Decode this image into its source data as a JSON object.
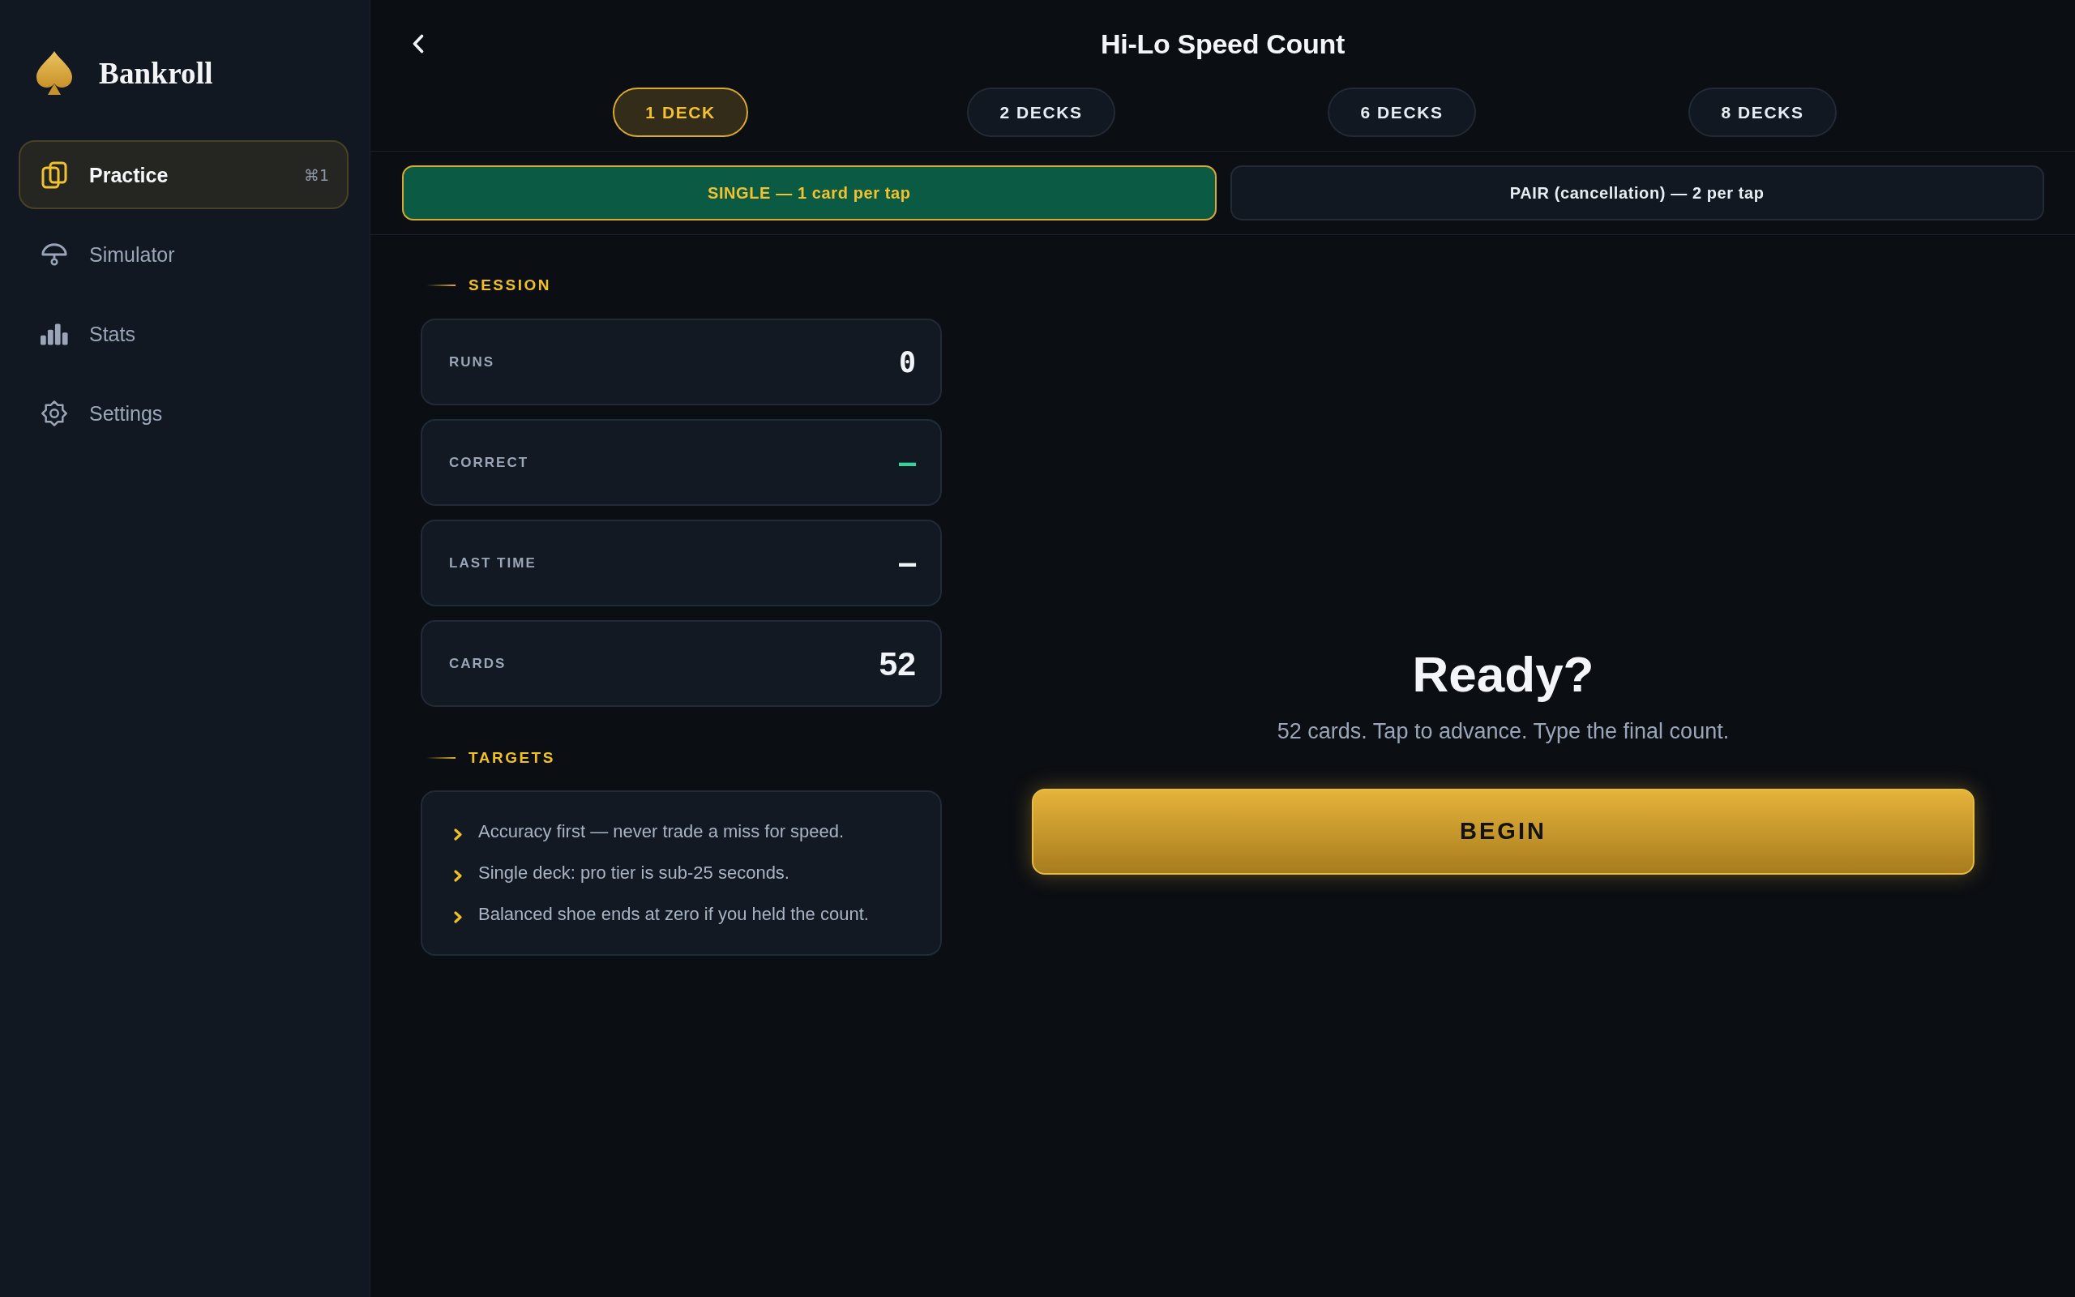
{
  "sidebar": {
    "brand": "Bankroll",
    "items": [
      {
        "label": "Practice",
        "shortcut": "⌘1",
        "selected": true
      },
      {
        "label": "Simulator",
        "selected": false
      },
      {
        "label": "Stats",
        "selected": false
      },
      {
        "label": "Settings",
        "selected": false
      }
    ]
  },
  "header": {
    "title": "Hi-Lo Speed Count"
  },
  "deck_tabs": [
    {
      "label": "1 DECK",
      "selected": true
    },
    {
      "label": "2 DECKS",
      "selected": false
    },
    {
      "label": "6 DECKS",
      "selected": false
    },
    {
      "label": "8 DECKS",
      "selected": false
    }
  ],
  "modes": [
    {
      "label": "SINGLE — 1 card per tap",
      "selected": true
    },
    {
      "label": "PAIR (cancellation) — 2 per tap",
      "selected": false
    }
  ],
  "session": {
    "heading": "SESSION",
    "stats": [
      {
        "label": "RUNS",
        "value": "0",
        "kind": "mono",
        "color": "#f1f5f9"
      },
      {
        "label": "CORRECT",
        "value": "—",
        "kind": "mono",
        "color": "#34d399"
      },
      {
        "label": "LAST TIME",
        "value": "—",
        "kind": "mono",
        "color": "#f1f5f9"
      },
      {
        "label": "CARDS",
        "value": "52",
        "kind": "plain",
        "color": "#f1f5f9"
      }
    ]
  },
  "targets": {
    "heading": "TARGETS",
    "items": [
      "Accuracy first — never trade a miss for speed.",
      "Single deck: pro tier is sub-25 seconds.",
      "Balanced shoe ends at zero if you held the count."
    ]
  },
  "ready": {
    "title": "Ready?",
    "subtitle": "52 cards. Tap to advance. Type the final count.",
    "button": "BEGIN"
  }
}
